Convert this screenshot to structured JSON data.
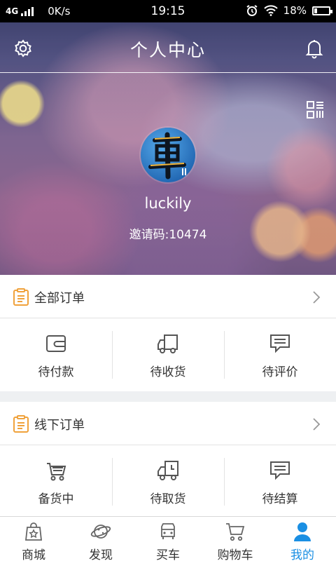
{
  "status_bar": {
    "network": "4G",
    "speed": "0K/s",
    "time": "19:15",
    "battery": "18%",
    "battery_level": 0.18
  },
  "header": {
    "title": "个人中心",
    "settings_icon": "gear-icon",
    "bell_icon": "bell-icon"
  },
  "profile": {
    "username": "luckily",
    "invite_code": "邀请码:10474",
    "qr_icon": "qr-code-icon"
  },
  "all_orders": {
    "title": "全部订单",
    "items": [
      {
        "label": "待付款",
        "icon": "wallet-icon"
      },
      {
        "label": "待收货",
        "icon": "truck-icon"
      },
      {
        "label": "待评价",
        "icon": "comment-icon"
      }
    ]
  },
  "offline_orders": {
    "title": "线下订单",
    "items": [
      {
        "label": "备货中",
        "icon": "cart-stock-icon"
      },
      {
        "label": "待取货",
        "icon": "pickup-truck-icon"
      },
      {
        "label": "待结算",
        "icon": "settle-icon"
      }
    ]
  },
  "tabbar": {
    "tabs": [
      {
        "label": "商城",
        "icon": "shop-bag-icon"
      },
      {
        "label": "发现",
        "icon": "planet-icon"
      },
      {
        "label": "买车",
        "icon": "car-icon"
      },
      {
        "label": "购物车",
        "icon": "cart-icon"
      },
      {
        "label": "我的",
        "icon": "person-icon",
        "active": true
      }
    ],
    "active_color": "#1a8fe3"
  }
}
